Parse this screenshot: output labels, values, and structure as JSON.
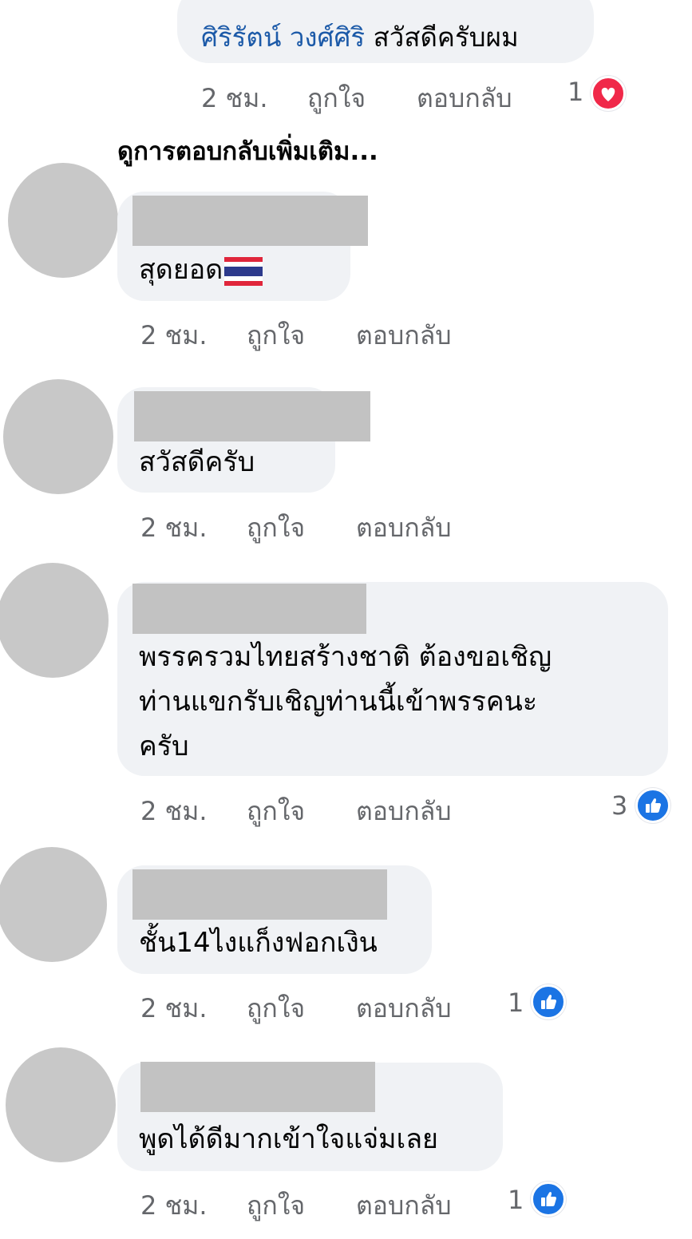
{
  "top_reply": {
    "author": "ศิริรัตน์ วงศ์ศิริ",
    "text": "สวัสดีครับผม",
    "time": "2 ชม.",
    "like_label": "ถูกใจ",
    "reply_label": "ตอบกลับ",
    "reaction_count": "1",
    "reaction_icon": "heart-reaction-icon",
    "reaction_color": "#f02849"
  },
  "more_replies_label": "ดูการตอบกลับเพิ่มเติม...",
  "comments": [
    {
      "text": "สุดยอด",
      "has_flag_emoji": true,
      "flag_emoji": "thailand-flag-emoji",
      "time": "2 ชม.",
      "like_label": "ถูกใจ",
      "reply_label": "ตอบกลับ",
      "reaction_count": ""
    },
    {
      "text": "สวัสดีครับ",
      "time": "2 ชม.",
      "like_label": "ถูกใจ",
      "reply_label": "ตอบกลับ",
      "reaction_count": ""
    },
    {
      "text_lines": [
        "พรรครวมไทยสร้างชาติ ต้องขอเชิญ",
        "ท่านแขกรับเชิญท่านนี้เข้าพรรคนะ",
        "ครับ"
      ],
      "time": "2 ชม.",
      "like_label": "ถูกใจ",
      "reply_label": "ตอบกลับ",
      "reaction_count": "3",
      "reaction_icon": "like-reaction-icon"
    },
    {
      "text": "ชั้น14ไงแก็งฟอกเงิน",
      "time": "2 ชม.",
      "like_label": "ถูกใจ",
      "reply_label": "ตอบกลับ",
      "reaction_count": "1",
      "reaction_icon": "like-reaction-icon"
    },
    {
      "text": "พูดได้ดีมากเข้าใจแจ่มเลย",
      "time": "2 ชม.",
      "like_label": "ถูกใจ",
      "reply_label": "ตอบกลับ",
      "reaction_count": "1",
      "reaction_icon": "like-reaction-icon"
    }
  ],
  "colors": {
    "bubble": "#f0f2f5",
    "meta_text": "#65676b",
    "mention": "#1c5aa8",
    "like_blue": "#1b74e4",
    "avatar_placeholder": "#c8c8c8",
    "redaction": "#c2c2c2"
  }
}
